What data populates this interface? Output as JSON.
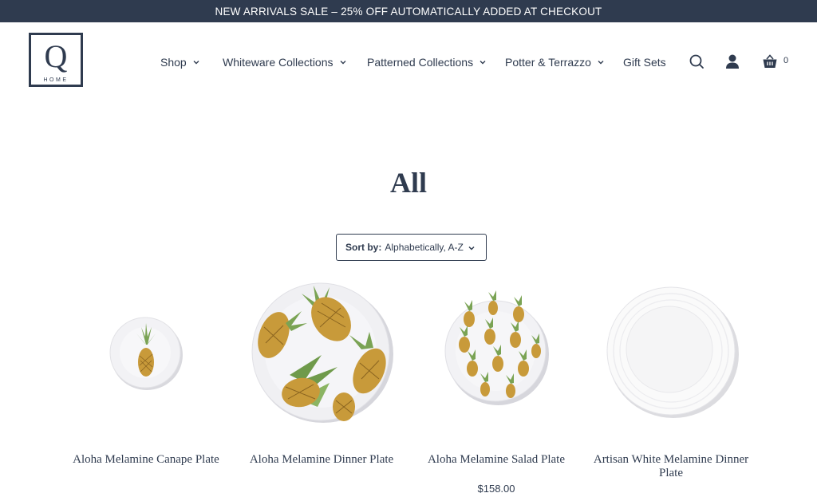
{
  "announcement": "NEW ARRIVALS SALE – 25% OFF AUTOMATICALLY ADDED AT CHECKOUT",
  "logo": {
    "letter": "Q",
    "word": "HOME"
  },
  "nav": {
    "items": [
      {
        "label": "Shop",
        "has_dropdown": true
      },
      {
        "label": "Whiteware Collections",
        "has_dropdown": true
      },
      {
        "label": "Patterned Collections",
        "has_dropdown": true
      },
      {
        "label": "Potter & Terrazzo",
        "has_dropdown": true
      },
      {
        "label": "Gift Sets",
        "has_dropdown": false
      }
    ],
    "icons": [
      "search-icon",
      "account-icon",
      "cart-icon"
    ],
    "cart_count": "0"
  },
  "page": {
    "title": "All",
    "sort": {
      "label": "Sort by:",
      "value": "Alphabetically, A-Z"
    }
  },
  "products": [
    {
      "name": "Aloha Melamine Canape Plate",
      "price": ""
    },
    {
      "name": "Aloha Melamine Dinner Plate",
      "price": ""
    },
    {
      "name": "Aloha Melamine Salad Plate",
      "price": "$158.00"
    },
    {
      "name": "Artisan White Melamine Dinner Plate",
      "price": ""
    }
  ],
  "colors": {
    "navy": "#2f3b4f",
    "background": "#ffffff",
    "pineapple_gold": "#c89a3a",
    "leaf_green": "#7aa354"
  }
}
